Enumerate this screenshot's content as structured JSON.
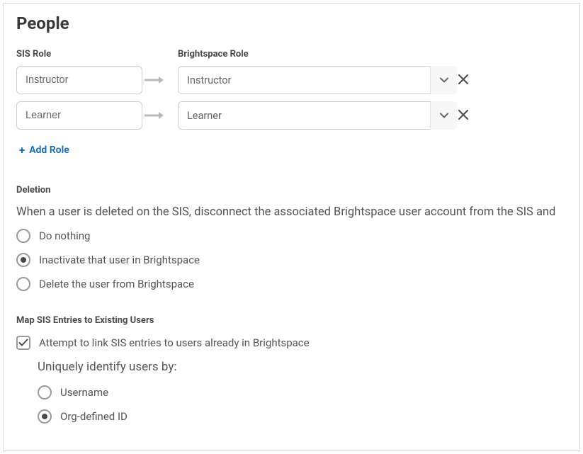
{
  "page": {
    "title": "People"
  },
  "roleMapping": {
    "sisHeader": "SIS Role",
    "brightspaceHeader": "Brightspace Role",
    "rows": [
      {
        "sisValue": "Instructor",
        "bsValue": "Instructor"
      },
      {
        "sisValue": "Learner",
        "bsValue": "Learner"
      }
    ],
    "addRoleLabel": "Add Role"
  },
  "deletion": {
    "sectionLabel": "Deletion",
    "description": "When a user is deleted on the SIS, disconnect the associated Brightspace user account from the SIS and",
    "options": [
      {
        "label": "Do nothing",
        "selected": false
      },
      {
        "label": "Inactivate that user in Brightspace",
        "selected": true
      },
      {
        "label": "Delete the user from Brightspace",
        "selected": false
      }
    ]
  },
  "mapping": {
    "sectionLabel": "Map SIS Entries to Existing Users",
    "checkbox": {
      "label": "Attempt to link SIS entries to users already in Brightspace",
      "checked": true
    },
    "identifyHeading": "Uniquely identify users by:",
    "identifyOptions": [
      {
        "label": "Username",
        "selected": false
      },
      {
        "label": "Org-defined ID",
        "selected": true
      }
    ]
  }
}
